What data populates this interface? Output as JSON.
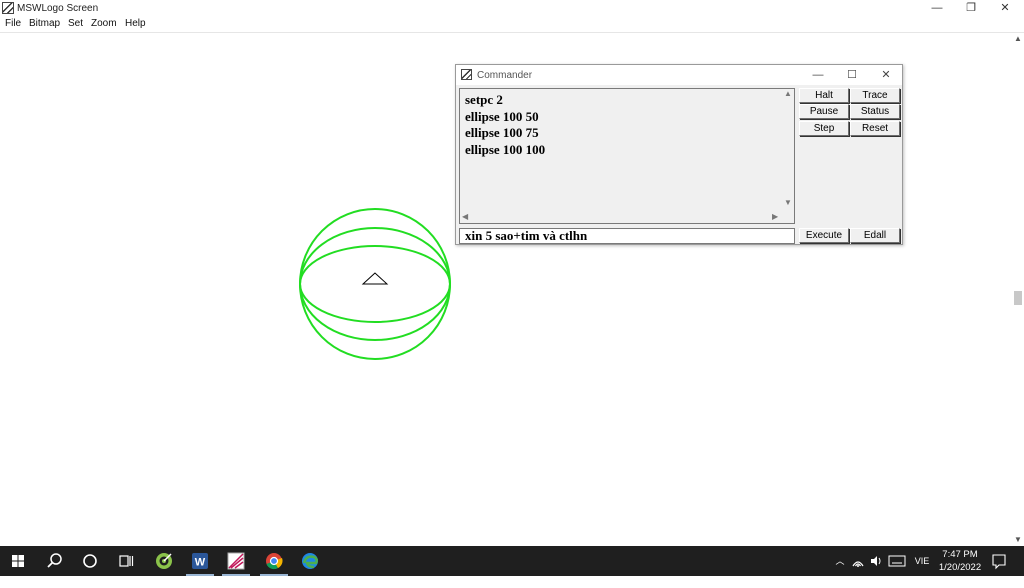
{
  "window": {
    "title": "MSWLogo Screen",
    "minimize_glyph": "—",
    "restore_glyph": "❐",
    "close_glyph": "✕"
  },
  "menu": [
    "File",
    "Bitmap",
    "Set",
    "Zoom",
    "Help"
  ],
  "canvas": {
    "pen_color": "#22dd22",
    "turtle_icon": "triangle-turtle-icon"
  },
  "commander": {
    "title": "Commander",
    "minimize_glyph": "—",
    "maximize_glyph": "☐",
    "close_glyph": "✕",
    "history": [
      "setpc 2",
      "ellipse 100 50",
      "ellipse 100 75",
      "ellipse 100 100"
    ],
    "input_value": "xin 5 sao+tim và ctlhn",
    "buttons": {
      "halt": "Halt",
      "trace": "Trace",
      "pause": "Pause",
      "status": "Status",
      "step": "Step",
      "reset": "Reset",
      "execute": "Execute",
      "edall": "Edall"
    }
  },
  "taskbar": {
    "apps": [
      "start-icon",
      "search-icon",
      "cortana-icon",
      "task-view-icon",
      "app-green-icon",
      "word-icon",
      "mswlogo-icon",
      "chrome-icon",
      "edge-icon"
    ],
    "language": "VIE",
    "time": "7:47 PM",
    "date": "1/20/2022"
  }
}
